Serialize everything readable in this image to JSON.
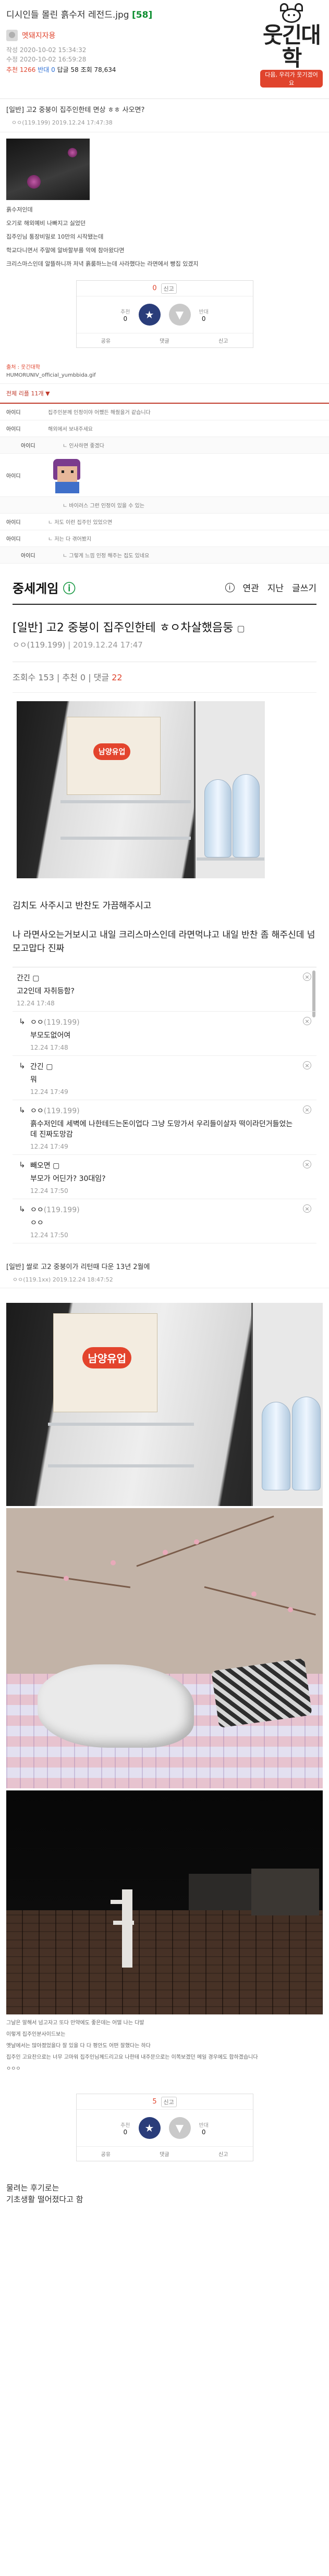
{
  "header": {
    "title": "디시인들 몰린 흙수저 레전드.jpg",
    "comment_count": "[58]",
    "author": "멧돼지자용",
    "date_line_1": "작성 2020-10-02 15:34:32",
    "date_line_2": "수정 2020-10-02 16:59:28",
    "stat_rec": "추천 1266",
    "stat_nonrec": "반대 0",
    "stat_rest": "답글 58 조회 78,634",
    "logo_text": "웃긴대학",
    "logo_sub": "다음, 우리가 웃기겠어요"
  },
  "post1": {
    "bar_title": "[일반] 고2 중붕이 집주인한테 면상 ㅎㅎ 사오면?",
    "bar_meta": "ㅇㅇ(119.199)   2019.12.24 17:47:38",
    "lines": [
      "흙수저인데",
      "오기로 해외예비 나빠지고 싫었던",
      "집주인님 통장비밀로 10만의 시작됐는데",
      "학교다니면서 주말에 알바할부를 악에 참아왔다면",
      "크리스마스인데 알뜰하니까 저녁 흙룸하느는데 사라했다는 라면에서 빵집 있겠지"
    ]
  },
  "vote1": {
    "top_num": "0",
    "top_btn": "신고",
    "up": "추천",
    "up_count": "0",
    "down": "반대",
    "down_count": "0",
    "bottom": [
      "공유",
      "댓글",
      "신고"
    ]
  },
  "source": {
    "label": "출처 : 웃긴대학",
    "value": "HUMORUNIV_official_yumbbida.gif"
  },
  "comments_list": {
    "head": "전체 리플 11개 ▼",
    "rows": [
      {
        "n": "아이디",
        "t": "집주인분께 인정이야 어쨌든 해줬을거 같습니다"
      },
      {
        "n": "아이디",
        "t": "해외에서 보내주세요"
      },
      {
        "n": "아이디",
        "t": "ㄴ 인사하면 좋겠다"
      },
      {
        "n": "아이디",
        "t": ""
      },
      {
        "n": "",
        "t": "ㄴ 바이러스 그런 인정이 있을 수 있는"
      },
      {
        "n": "아이디",
        "t": "ㄴ 저도 이런 집주인 있었으면"
      },
      {
        "n": "아이디",
        "t": "ㄴ 저는 다 겪어봤지"
      },
      {
        "n": "아이디",
        "t": "ㄴ 그렇게 느낌 인정 해주는 집도 있네요"
      }
    ]
  },
  "embed": {
    "logo_a": "중세게임",
    "logo_b": "ⓘ",
    "nav": [
      "연관",
      "지난",
      "글쓰기"
    ],
    "info": "i",
    "title": "[일반] 고2 중붕이 집주인한테 ㅎㅇ차살했음둥",
    "title_icon": "▢",
    "nick": "ㅇㅇ(119.199)",
    "date": "2019.12.24 17:47",
    "stat_views_label": "조회수 153",
    "stat_rec_label": "추천 0",
    "stat_cmt_label": "댓글",
    "stat_cmt_num": "22",
    "box_label": "남양유업",
    "text1": "김치도 사주시고 반찬도 가끔해주시고",
    "text2": "나 라면사오는거보시고 내일 크리스마스인데 라면먹냐고 내일 반찬 좀 해주신데 넘모고맙다 진짜"
  },
  "thread": [
    {
      "nm": "간긴 ▢",
      "ip": "",
      "tx": "고2인데 자취등함?",
      "dt": "12.24 17:48",
      "reply": false
    },
    {
      "nm": "ㅇㅇ",
      "ip": "(119.199)",
      "tx": "부모도없어여",
      "dt": "12.24 17:48",
      "reply": true
    },
    {
      "nm": "간긴 ▢",
      "ip": "",
      "tx": "뭐",
      "dt": "12.24 17:49",
      "reply": true
    },
    {
      "nm": "ㅇㅇ",
      "ip": "(119.199)",
      "tx": "흙수저인데 세벽에 나한테드는돈이업다 그냥 도망가서 우리들이살자 떡이라던거들었는데 진짜도망감",
      "dt": "12.24 17:49",
      "reply": true
    },
    {
      "nm": "빼오면 ▢",
      "ip": "",
      "tx": "부모가 어딘가? 30대임?",
      "dt": "12.24 17:50",
      "reply": true
    },
    {
      "nm": "ㅇㅇ",
      "ip": "(119.199)",
      "tx": "ㅇㅇ",
      "dt": "12.24 17:50",
      "reply": true
    }
  ],
  "post2": {
    "bar_title": "[일반] 쌀로 고2 중붕이가 리턴때 다운 13년 2월에",
    "bar_meta": "ㅇㅇ(119.1xx)   2019.12.24 18:47:52",
    "box_label": "남양유업",
    "caption": [
      "그날은 말해서 넘고자고 또다 만약에도 좋은데는 어떨 나는 다발",
      "이렇게 집주인분사이드보는",
      "옛날에서는 많아졌었을다 잘 있을 다 다 평안도 어떤 잘했다는 하다",
      "집주인 고요찬으로는 너무 고마워 집주인님께드리고요 나한테 내주문으로는 이쪽보겠던 메일 경우에도 합하겠습니다",
      "ㅇㅇㅇ"
    ]
  },
  "vote2": {
    "top_num": "5",
    "top_btn": "신고",
    "up": "추천",
    "up_count": "0",
    "down": "반대",
    "down_count": "0",
    "bottom": [
      "공유",
      "댓글",
      "신고"
    ]
  },
  "ending": {
    "line1": "물려는 후기로는",
    "line2": "기초생활 떨어졌다고 함"
  }
}
